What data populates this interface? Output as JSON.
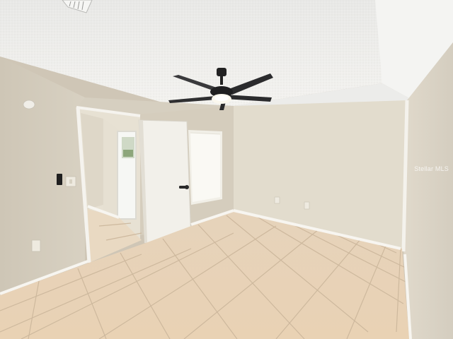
{
  "watermark": {
    "text": "Stellar MLS"
  },
  "colors": {
    "ceiling": "#efefed",
    "wall_left": "#d2cbbd",
    "wall_back": "#e2dccd",
    "wall_right": "#ddd6c8",
    "floor": "#e8d3b8",
    "grout": "#c9b49a",
    "baseboard": "#f6f4ef",
    "door": "#f3f1ec",
    "window": "#f8f7f2",
    "fan_blade": "#2b2b2d",
    "fan_light": "#fbf8ee"
  },
  "icons": [
    "ceiling-fan-icon",
    "door-handle-icon",
    "light-switch-icon",
    "power-outlet-icon",
    "smoke-detector-icon",
    "air-vent-icon"
  ]
}
